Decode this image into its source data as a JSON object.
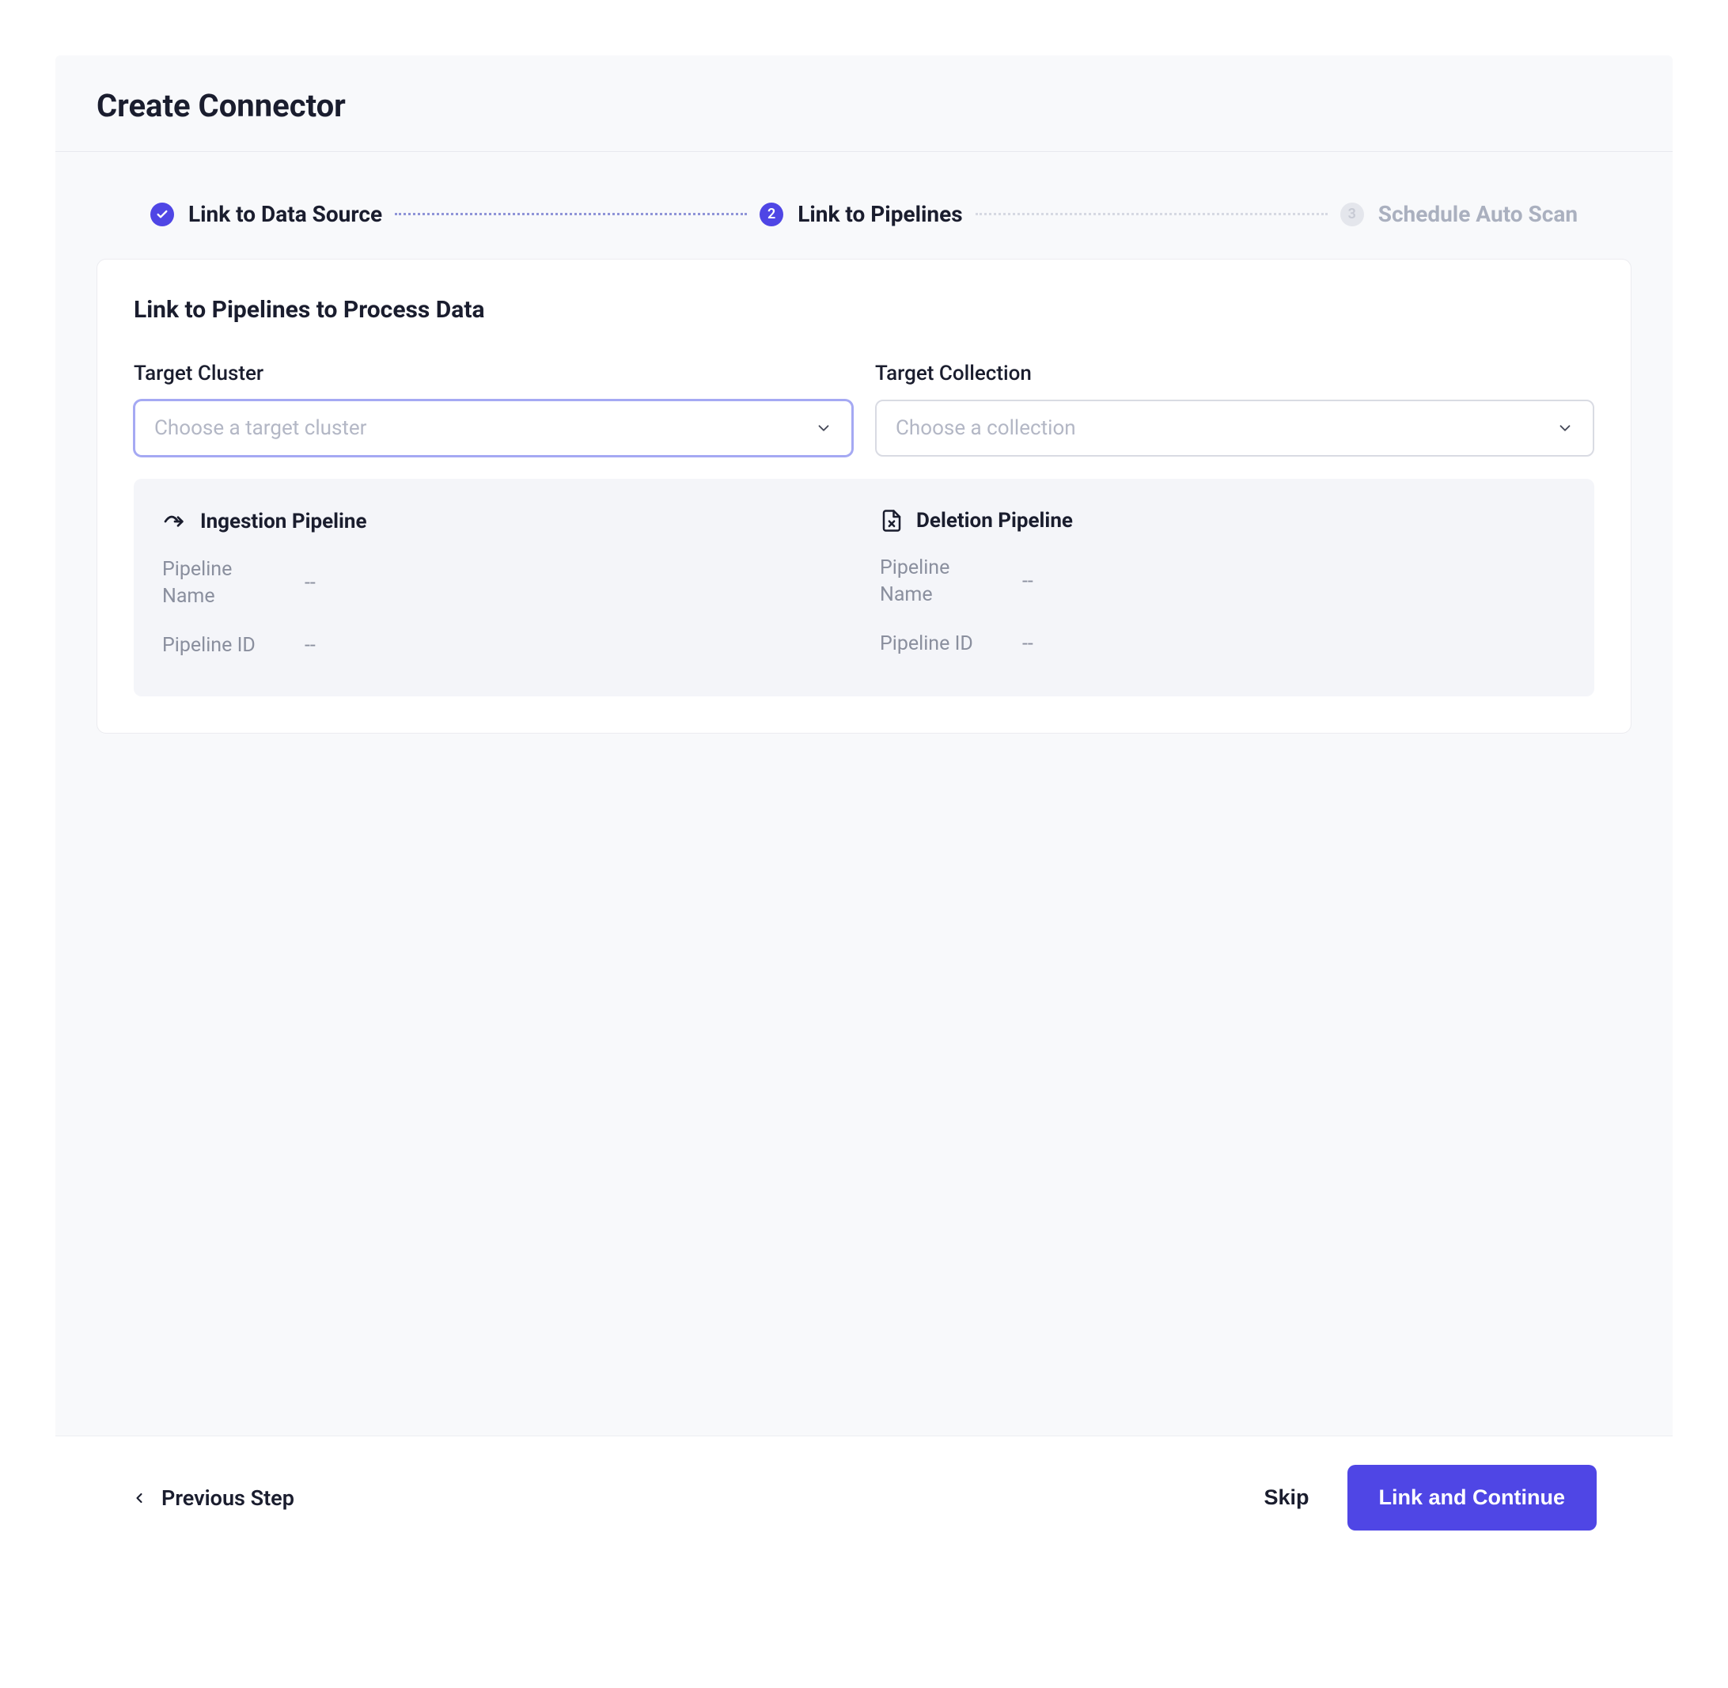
{
  "header": {
    "title": "Create Connector"
  },
  "stepper": {
    "steps": [
      {
        "label": "Link to Data Source",
        "state": "done",
        "badge": "✓"
      },
      {
        "label": "Link to Pipelines",
        "state": "current",
        "badge": "2"
      },
      {
        "label": "Schedule Auto Scan",
        "state": "upcoming",
        "badge": "3"
      }
    ]
  },
  "card": {
    "title": "Link to Pipelines to Process Data",
    "target_cluster": {
      "label": "Target Cluster",
      "placeholder": "Choose a target cluster"
    },
    "target_collection": {
      "label": "Target Collection",
      "placeholder": "Choose a collection"
    },
    "ingestion": {
      "title": "Ingestion Pipeline",
      "name_label": "Pipeline Name",
      "name_value": "--",
      "id_label": "Pipeline ID",
      "id_value": "--"
    },
    "deletion": {
      "title": "Deletion Pipeline",
      "name_label": "Pipeline Name",
      "name_value": "--",
      "id_label": "Pipeline ID",
      "id_value": "--"
    }
  },
  "footer": {
    "previous_label": "Previous Step",
    "skip_label": "Skip",
    "continue_label": "Link and Continue"
  }
}
